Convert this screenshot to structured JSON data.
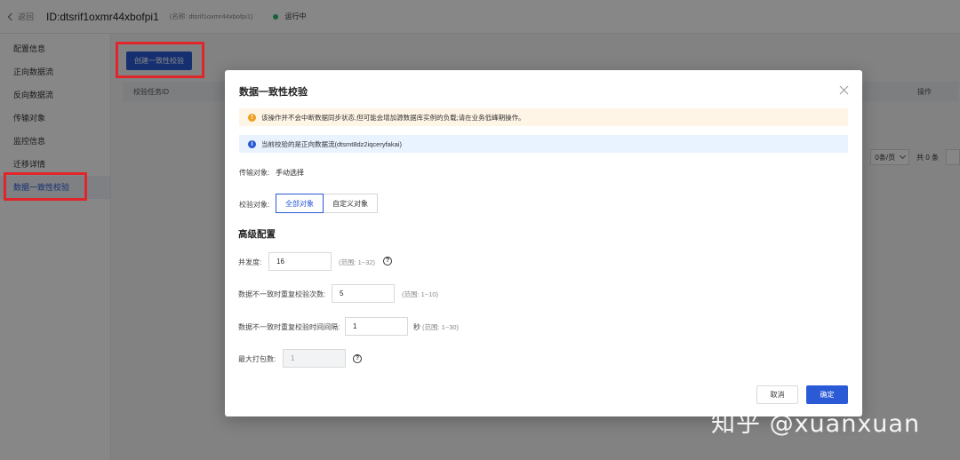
{
  "topbar": {
    "back_label": "返回",
    "instance_id": "ID:dtsrif1oxmr44xbofpi1",
    "alias": "(名称: dtsrif1oxmr44xbofpi1)",
    "status": "运行中",
    "status_color": "#2bb673"
  },
  "sidebar": {
    "items": [
      {
        "label": "配置信息"
      },
      {
        "label": "正向数据流"
      },
      {
        "label": "反向数据流"
      },
      {
        "label": "传输对象"
      },
      {
        "label": "监控信息"
      },
      {
        "label": "迁移详情"
      },
      {
        "label": "数据一致性校验"
      }
    ],
    "active_index": 6
  },
  "content": {
    "create_button": "创建一致性校验",
    "table_headers": [
      "校验任务ID",
      "操作"
    ],
    "pager": {
      "size_label": "0条/页",
      "total": "共 0 条"
    }
  },
  "modal": {
    "title": "数据一致性校验",
    "warning": "该操作并不会中断数据同步状态,但可能会增加源数据库实例的负载;请在业务低峰期操作。",
    "info": "当前校验的是正向数据流(dtsmt8dz2iqceryfakai)",
    "transfer_label": "传输对象:",
    "transfer_value": "手动选择",
    "check_label": "校验对象:",
    "check_options": [
      "全部对象",
      "自定义对象"
    ],
    "check_selected": 0,
    "advanced_title": "高级配置",
    "concurrency": {
      "label": "并发度:",
      "value": "16",
      "hint": "(范围: 1~32)"
    },
    "retry_times": {
      "label": "数据不一致时重复校验次数:",
      "value": "5",
      "hint": "(范围: 1~10)"
    },
    "retry_interval": {
      "label": "数据不一致时重复校验时间间隔:",
      "value": "1",
      "unit": "秒",
      "hint": "(范围: 1~30)"
    },
    "max_pack": {
      "label": "最大打包数:",
      "value": "1"
    },
    "cancel": "取消",
    "confirm": "确定"
  },
  "colors": {
    "accent": "#2a5ad6",
    "highlight_box": "#e0262a",
    "warning_bg": "#fff5e6",
    "info_bg": "#e9f2ff"
  },
  "watermark": "知乎 @xuanxuan"
}
